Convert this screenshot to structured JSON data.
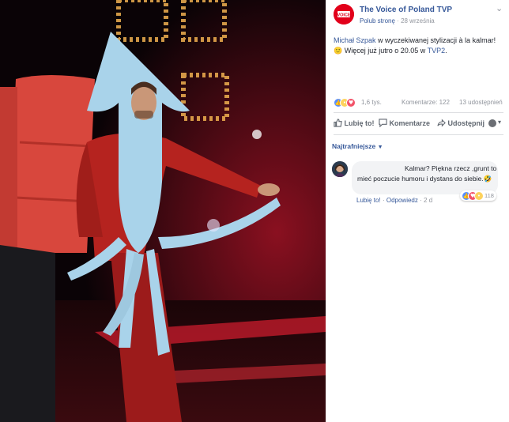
{
  "page": {
    "name": "The Voice of Poland TVP",
    "like_page_label": "Polub stronę",
    "separator": "·",
    "date": "28 września",
    "logo_text": "VOICE",
    "brand_color": "#e2001a"
  },
  "post": {
    "mention_name": "Michał Szpak",
    "text_part1": " w wyczekiwanej stylizacji à la kalmar!",
    "emoji": "🙂",
    "text_part2": " Więcej już jutro o 20.05 w ",
    "channel_link": "TVP2",
    "text_end": "."
  },
  "stats": {
    "reactions_count": "1,6 tys.",
    "comments": "Komentarze: 122",
    "shares": "13 udostępnień"
  },
  "actions": {
    "like": "Lubię to!",
    "comment": "Komentarze",
    "share": "Udostępnij"
  },
  "sort": {
    "label": "Najtrafniejsze"
  },
  "comment": {
    "text": "Kalmar? Piękna rzecz ,grunt to mieć poczucie humoru i dystans do siebie.",
    "emoji": "🤣",
    "reactions_count": "118",
    "like": "Lubię to!",
    "reply": "Odpowiedz",
    "age": "2 d"
  },
  "icons": {
    "like": "thumbs-up-icon",
    "comment": "speech-bubble-icon",
    "share": "share-arrow-icon",
    "dropdown": "caret-down-icon"
  },
  "colors": {
    "link": "#365899",
    "meta": "#90949c",
    "like_blue": "#5890ff",
    "love_red": "#f25268",
    "haha_yellow": "#fdd25c"
  }
}
